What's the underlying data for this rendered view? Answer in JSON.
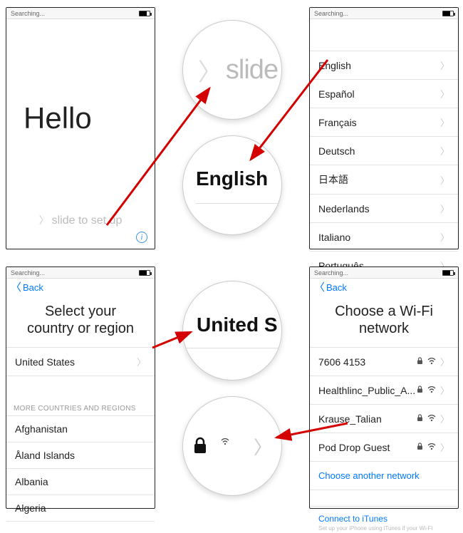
{
  "status": {
    "searching": "Searching..."
  },
  "nav": {
    "back": "Back"
  },
  "screen1": {
    "hello": "Hello",
    "slide": "slide to set up",
    "info": "i"
  },
  "bubbles": {
    "slide": "slide",
    "english": "English",
    "united": "United S"
  },
  "languages": [
    "English",
    "Español",
    "Français",
    "Deutsch",
    "日本語",
    "Nederlands",
    "Italiano",
    "Português"
  ],
  "region": {
    "title": "Select your country or region",
    "first": "United States",
    "more_head": "MORE COUNTRIES AND REGIONS",
    "more": [
      "Afghanistan",
      "Åland Islands",
      "Albania",
      "Algeria"
    ]
  },
  "wifi": {
    "title": "Choose a Wi-Fi network",
    "networks": [
      {
        "name": "7606 4153",
        "locked": true
      },
      {
        "name": "Healthlinc_Public_A...",
        "locked": true
      },
      {
        "name": "Krause_Talian",
        "locked": true
      },
      {
        "name": "Pod Drop Guest",
        "locked": true
      }
    ],
    "choose_other": "Choose another network",
    "connect": "Connect to iTunes",
    "footnote": "Set up your iPhone using iTunes if your Wi-Fi"
  }
}
